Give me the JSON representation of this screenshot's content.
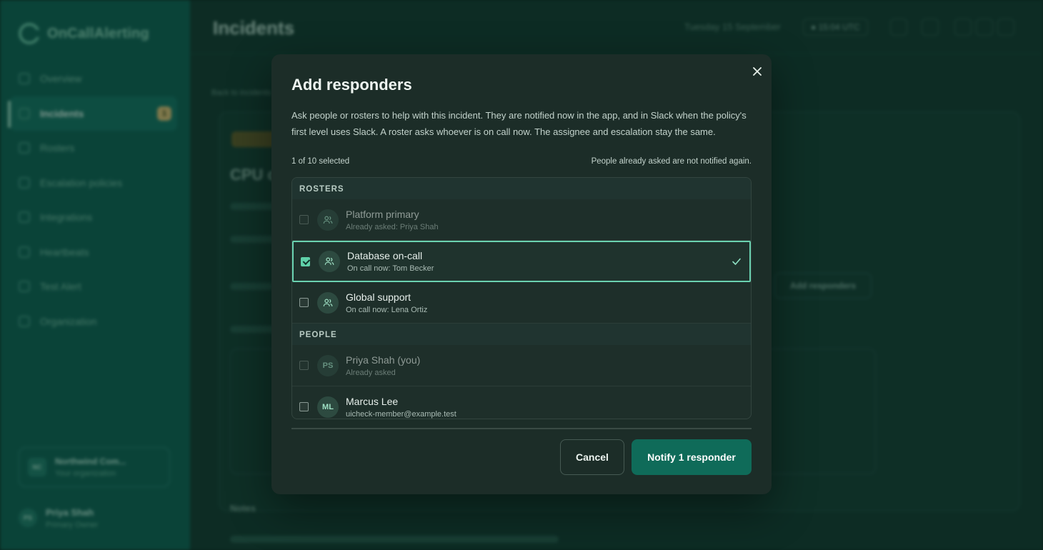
{
  "app": {
    "brand_name": "OnCallAlerting",
    "nav": [
      {
        "label": "Overview",
        "icon": "grid-icon"
      },
      {
        "label": "Incidents",
        "icon": "alert-icon",
        "badge": "1"
      },
      {
        "label": "Rosters",
        "icon": "calendar-icon"
      },
      {
        "label": "Escalation policies",
        "icon": "escalation-icon"
      },
      {
        "label": "Integrations",
        "icon": "plug-icon"
      },
      {
        "label": "Heartbeats",
        "icon": "heart-icon"
      },
      {
        "label": "Test Alert",
        "icon": "bell-icon"
      },
      {
        "label": "Organization",
        "icon": "building-icon"
      }
    ],
    "org": {
      "avatar": "NC",
      "name": "Northwind Com...",
      "sub": "Your organization"
    },
    "user": {
      "avatar": "PS",
      "name": "Priya Shah",
      "sub": "Primary Owner"
    },
    "page_title": "Incidents",
    "top_date": "Tuesday 15 September",
    "top_time": "● 15:04 UTC",
    "back_link": "Back to incidents",
    "bg_heading": "CPU c",
    "bg_button": "Add responders",
    "bg_label": "Notes"
  },
  "modal": {
    "title": "Add responders",
    "description": "Ask people or rosters to help with this incident. They are notified now in the app, and in Slack when the policy's first level uses Slack. A roster asks whoever is on call now. The assignee and escalation stay the same.",
    "selected_count": "1 of 10 selected",
    "note": "People already asked are not notified again.",
    "sections": {
      "rosters_header": "ROSTERS",
      "people_header": "PEOPLE"
    },
    "rosters": [
      {
        "name": "Platform primary",
        "sub": "Already asked: Priya Shah",
        "state": "disabled"
      },
      {
        "name": "Database on-call",
        "sub": "On call now: Tom Becker",
        "state": "selected"
      },
      {
        "name": "Global support",
        "sub": "On call now: Lena Ortiz",
        "state": "unselected"
      }
    ],
    "people": [
      {
        "initials": "PS",
        "name": "Priya Shah (you)",
        "sub": "Already asked",
        "state": "disabled"
      },
      {
        "initials": "ML",
        "name": "Marcus Lee",
        "sub": "uicheck-member@example.test",
        "state": "unselected"
      }
    ],
    "cancel_label": "Cancel",
    "notify_label": "Notify 1 responder"
  },
  "colors": {
    "accent": "#0f6b59",
    "selected_border": "#6ad2b0",
    "modal_bg": "#1c2d28"
  }
}
